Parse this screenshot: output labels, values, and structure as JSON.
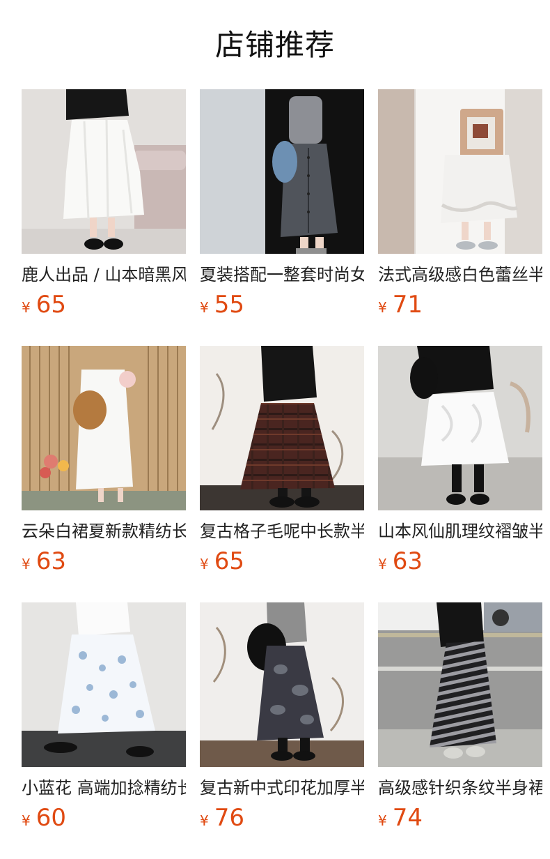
{
  "page": {
    "title": "店铺推荐"
  },
  "products": [
    {
      "name": "鹿人出品 / 山本暗黑风",
      "currency": "¥",
      "price": "65"
    },
    {
      "name": "夏装搭配一整套时尚女装",
      "currency": "¥",
      "price": "55"
    },
    {
      "name": "法式高级感白色蕾丝半身裙",
      "currency": "¥",
      "price": "71"
    },
    {
      "name": "云朵白裙夏新款精纺长裙",
      "currency": "¥",
      "price": "63"
    },
    {
      "name": "复古格子毛呢中长款半身裙",
      "currency": "¥",
      "price": "65"
    },
    {
      "name": "山本风仙肌理纹褶皱半身裙",
      "currency": "¥",
      "price": "63"
    },
    {
      "name": "小蓝花 高端加捻精纺长裙",
      "currency": "¥",
      "price": "60"
    },
    {
      "name": "复古新中式印花加厚半身裙",
      "currency": "¥",
      "price": "76"
    },
    {
      "name": "高级感针织条纹半身裙",
      "currency": "¥",
      "price": "74"
    }
  ],
  "theme": {
    "price_color": "#e04a12",
    "text_color": "#222222",
    "background": "#ffffff"
  }
}
